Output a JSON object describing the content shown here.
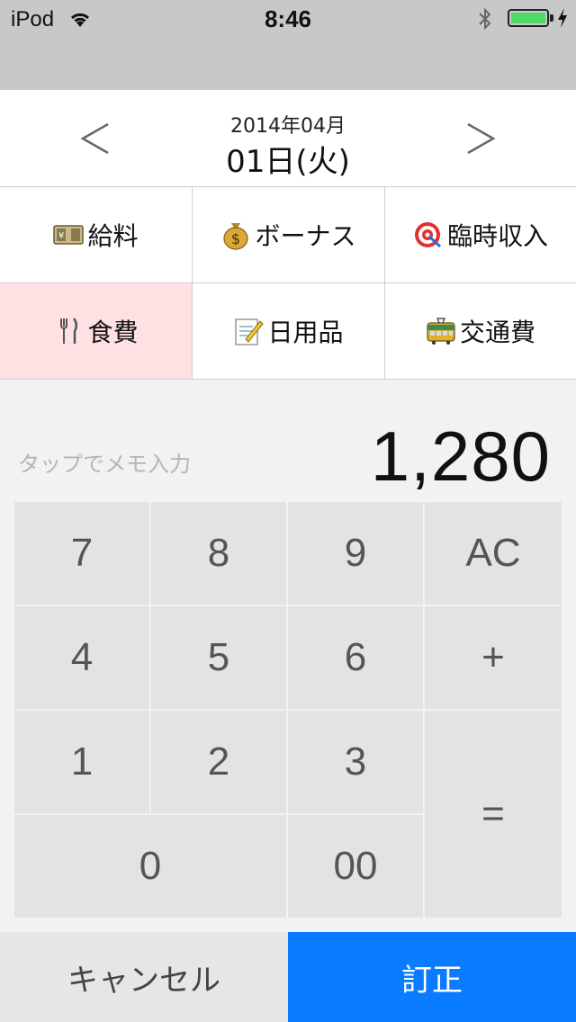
{
  "status_bar": {
    "carrier": "iPod",
    "time": "8:46",
    "battery_level": 1.0,
    "wifi_icon": "wifi-icon",
    "bluetooth_icon": "bluetooth-icon",
    "battery_icon": "battery-icon",
    "charging_icon": "charging-bolt-icon"
  },
  "date_header": {
    "prev": "<",
    "next": ">",
    "month": "2014年04月",
    "day": "01日(火)"
  },
  "categories": [
    {
      "icon": "cash-icon",
      "label": "給料",
      "selected": false
    },
    {
      "icon": "money-bag-icon",
      "label": "ボーナス",
      "selected": false
    },
    {
      "icon": "target-icon",
      "label": "臨時収入",
      "selected": false
    },
    {
      "icon": "fork-knife-icon",
      "label": "食費",
      "selected": true
    },
    {
      "icon": "memo-icon",
      "label": "日用品",
      "selected": false
    },
    {
      "icon": "train-icon",
      "label": "交通費",
      "selected": false
    }
  ],
  "entry": {
    "memo_placeholder": "タップでメモ入力",
    "amount": "1,280"
  },
  "keypad": {
    "k7": "7",
    "k8": "8",
    "k9": "9",
    "ac": "AC",
    "k4": "4",
    "k5": "5",
    "k6": "6",
    "plus": "+",
    "k1": "1",
    "k2": "2",
    "k3": "3",
    "equals": "=",
    "k0": "0",
    "k00": "00"
  },
  "actions": {
    "cancel": "キャンセル",
    "confirm": "訂正"
  },
  "colors": {
    "selected_category_bg": "#ffe0e3",
    "confirm_bg": "#0a7cff",
    "battery_green": "#4cd964"
  }
}
